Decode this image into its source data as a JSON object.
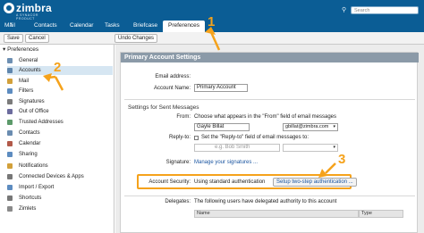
{
  "header": {
    "logo_text": "zimbra",
    "logo_sub": "A SYNACOR PRODUCT",
    "search_placeholder": "Search",
    "tabs": [
      "Mail",
      "Contacts",
      "Calendar",
      "Tasks",
      "Briefcase",
      "Preferences"
    ],
    "active_tab": "Preferences"
  },
  "toolbar": {
    "save_label": "Save",
    "cancel_label": "Cancel",
    "undo_label": "Undo Changes"
  },
  "sidebar": {
    "heading": "Preferences",
    "items": [
      {
        "label": "General",
        "icon": "general-icon",
        "color": "#6d8fb2"
      },
      {
        "label": "Accounts",
        "icon": "accounts-icon",
        "color": "#5f86ad"
      },
      {
        "label": "Mail",
        "icon": "mail-icon",
        "color": "#d2a03a"
      },
      {
        "label": "Filters",
        "icon": "filters-icon",
        "color": "#5d8cc0"
      },
      {
        "label": "Signatures",
        "icon": "signatures-icon",
        "color": "#7b7b7b"
      },
      {
        "label": "Out of Office",
        "icon": "out-of-office-icon",
        "color": "#6c6c9e"
      },
      {
        "label": "Trusted Addresses",
        "icon": "trusted-addresses-icon",
        "color": "#5c9a6a"
      },
      {
        "label": "Contacts",
        "icon": "contacts-icon",
        "color": "#6a8cb0"
      },
      {
        "label": "Calendar",
        "icon": "calendar-icon",
        "color": "#b25a4a"
      },
      {
        "label": "Sharing",
        "icon": "sharing-icon",
        "color": "#5d8cc0"
      },
      {
        "label": "Notifications",
        "icon": "notifications-icon",
        "color": "#d2a03a"
      },
      {
        "label": "Connected Devices & Apps",
        "icon": "devices-icon",
        "color": "#777777"
      },
      {
        "label": "Import / Export",
        "icon": "import-export-icon",
        "color": "#5d8cc0"
      },
      {
        "label": "Shortcuts",
        "icon": "shortcuts-icon",
        "color": "#777777"
      },
      {
        "label": "Zimlets",
        "icon": "zimlets-icon",
        "color": "#8a8a8a"
      }
    ],
    "active_index": 1
  },
  "main": {
    "section_title": "Primary Account Settings",
    "email_label": "Email address:",
    "account_name_label": "Account Name:",
    "account_name_value": "Primary Account",
    "sent_heading": "Settings for Sent Messages",
    "from_label": "From:",
    "from_text": "Choose what appears in the \"From\" field of email messages",
    "from_name_value": "Gayle Billat",
    "from_email_value": "gbillat@zimbra.com",
    "reply_label": "Reply-to:",
    "reply_check_text": "Set the \"Reply-to\" field of email messages to:",
    "reply_name_placeholder": "e.g. Bob Smith",
    "signature_label": "Signature:",
    "signature_link": "Manage your signatures ...",
    "security_label": "Account Security:",
    "security_value": "Using standard authentication",
    "setup_button": "Setup two-step authentication ...",
    "delegates_label": "Delegates:",
    "delegates_text": "The following users have delegated authority to this account",
    "table_columns": [
      "Name",
      "Type"
    ]
  },
  "annotations": [
    "1",
    "2",
    "3"
  ],
  "colors": {
    "header": "#0b5d95",
    "annotation": "#f5a21b",
    "selected_row": "#d6e6f2",
    "section_header": "#8b9aa8"
  }
}
